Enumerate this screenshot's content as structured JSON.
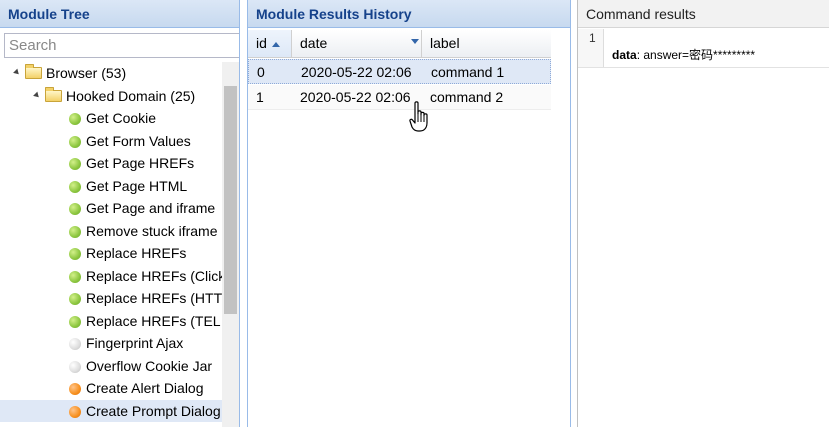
{
  "module_tree": {
    "title": "Module Tree",
    "search_placeholder": "Search",
    "items": [
      {
        "label": "Browser (53)",
        "type": "folder",
        "level": 0
      },
      {
        "label": "Hooked Domain (25)",
        "type": "folder",
        "level": 1
      },
      {
        "label": "Get Cookie",
        "type": "module",
        "status": "green"
      },
      {
        "label": "Get Form Values",
        "type": "module",
        "status": "green"
      },
      {
        "label": "Get Page HREFs",
        "type": "module",
        "status": "green"
      },
      {
        "label": "Get Page HTML",
        "type": "module",
        "status": "green"
      },
      {
        "label": "Get Page and iframe",
        "type": "module",
        "status": "green"
      },
      {
        "label": "Remove stuck iframe",
        "type": "module",
        "status": "green"
      },
      {
        "label": "Replace HREFs",
        "type": "module",
        "status": "green"
      },
      {
        "label": "Replace HREFs (Click",
        "type": "module",
        "status": "green"
      },
      {
        "label": "Replace HREFs (HTT",
        "type": "module",
        "status": "green"
      },
      {
        "label": "Replace HREFs (TEL",
        "type": "module",
        "status": "green"
      },
      {
        "label": "Fingerprint Ajax",
        "type": "module",
        "status": "grey"
      },
      {
        "label": "Overflow Cookie Jar",
        "type": "module",
        "status": "grey"
      },
      {
        "label": "Create Alert Dialog",
        "type": "module",
        "status": "orange"
      },
      {
        "label": "Create Prompt Dialog",
        "type": "module",
        "status": "orange",
        "selected": true
      }
    ]
  },
  "results_history": {
    "title": "Module Results History",
    "columns": {
      "id": "id",
      "date": "date",
      "label": "label"
    },
    "rows": [
      {
        "id": "0",
        "date": "2020-05-22 02:06",
        "label": "command 1"
      },
      {
        "id": "1",
        "date": "2020-05-22 02:06",
        "label": "command 2"
      }
    ]
  },
  "command_results": {
    "title": "Command results",
    "line_number": "1",
    "key": "data",
    "value": ": answer=密码*********"
  },
  "colors": {
    "header_text": "#15428b",
    "selection": "#dfe8f6",
    "status_green": "#8cc63f",
    "status_grey": "#dddddd",
    "status_orange": "#f7901e"
  }
}
